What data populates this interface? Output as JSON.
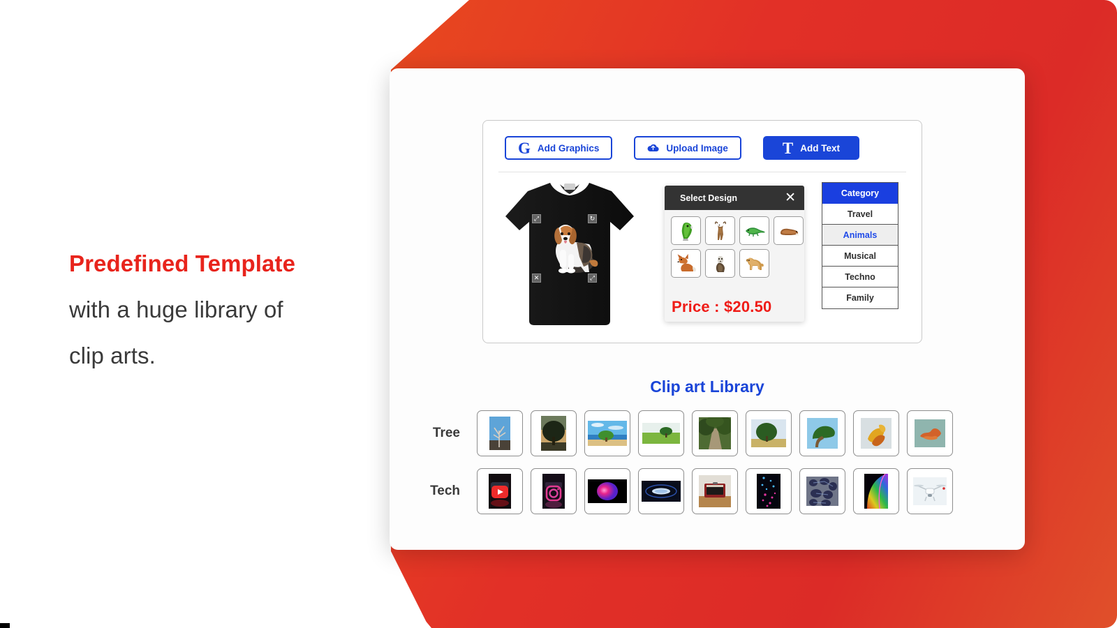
{
  "hero": {
    "lines": [
      {
        "text": "Predefined Template",
        "style": "accent"
      },
      {
        "text": "with a huge library of",
        "style": "plain"
      },
      {
        "text": "clip arts.",
        "style": "plain"
      }
    ],
    "accent_color": "#e8241c",
    "text_color": "#3a3a3a"
  },
  "background": {
    "panel_gradient_from": "#e8491f",
    "panel_gradient_to": "#dc2b27"
  },
  "toolbar": {
    "buttons": [
      {
        "label": "Add Graphics",
        "icon": "graphics-g-icon",
        "glyph": "G",
        "style": "outline"
      },
      {
        "label": "Upload Image",
        "icon": "cloud-upload-icon",
        "glyph": "☁",
        "style": "outline"
      },
      {
        "label": "Add Text",
        "icon": "text-t-icon",
        "glyph": "T",
        "style": "solid"
      }
    ],
    "accent_color": "#1a45d8"
  },
  "preview": {
    "product": "black-tshirt",
    "design": "beagle-dog",
    "handles": [
      {
        "name": "resize-handle-top-left",
        "glyph": "⤡"
      },
      {
        "name": "rotate-handle-top-right",
        "glyph": "↻"
      },
      {
        "name": "delete-handle-bottom-left",
        "glyph": "✕"
      },
      {
        "name": "resize-handle-bottom-right",
        "glyph": "⤡"
      }
    ]
  },
  "popup": {
    "title": "Select Design",
    "close_label": "✕",
    "price": "Price : $20.50",
    "price_color": "#ef1c17",
    "designs": [
      {
        "name": "parrot",
        "type": "bird"
      },
      {
        "name": "deer",
        "type": "mammal"
      },
      {
        "name": "lizard",
        "type": "reptile"
      },
      {
        "name": "walrus",
        "type": "mammal"
      },
      {
        "name": "fox",
        "type": "mammal"
      },
      {
        "name": "ferret",
        "type": "mammal"
      },
      {
        "name": "dog",
        "type": "mammal"
      }
    ]
  },
  "categories": {
    "header": "Category",
    "items": [
      {
        "label": "Travel",
        "active": false
      },
      {
        "label": "Animals",
        "active": true
      },
      {
        "label": "Musical",
        "active": false
      },
      {
        "label": "Techno",
        "active": false
      },
      {
        "label": "Family",
        "active": false
      }
    ],
    "header_bg": "#1a3fe0",
    "active_color": "#1f4ae8"
  },
  "library": {
    "title": "Clip art Library",
    "title_color": "#1a45d8",
    "rows": [
      {
        "label": "Tree",
        "items": [
          {
            "name": "bare-tree-blue-sky",
            "kind": "tall"
          },
          {
            "name": "dark-oak-field",
            "kind": "tall"
          },
          {
            "name": "beach-tree-sea",
            "kind": "wide"
          },
          {
            "name": "lone-tree-green-field",
            "kind": "wide"
          },
          {
            "name": "forest-path",
            "kind": "square"
          },
          {
            "name": "tree-on-meadow",
            "kind": "wide"
          },
          {
            "name": "wide-canopy-tree",
            "kind": "square"
          },
          {
            "name": "autumn-leaves",
            "kind": "square"
          },
          {
            "name": "orange-coral-tree",
            "kind": "square"
          }
        ]
      },
      {
        "label": "Tech",
        "items": [
          {
            "name": "youtube-logo",
            "kind": "tall"
          },
          {
            "name": "instagram-logo",
            "kind": "tall"
          },
          {
            "name": "magenta-orb",
            "kind": "wide"
          },
          {
            "name": "blue-disc-ring",
            "kind": "wide"
          },
          {
            "name": "vintage-amplifier",
            "kind": "square"
          },
          {
            "name": "neon-light-strands",
            "kind": "tall"
          },
          {
            "name": "blue-network-nodes",
            "kind": "square"
          },
          {
            "name": "rainbow-led-grid",
            "kind": "tall"
          },
          {
            "name": "white-quadcopter-drone",
            "kind": "square"
          }
        ]
      }
    ]
  }
}
